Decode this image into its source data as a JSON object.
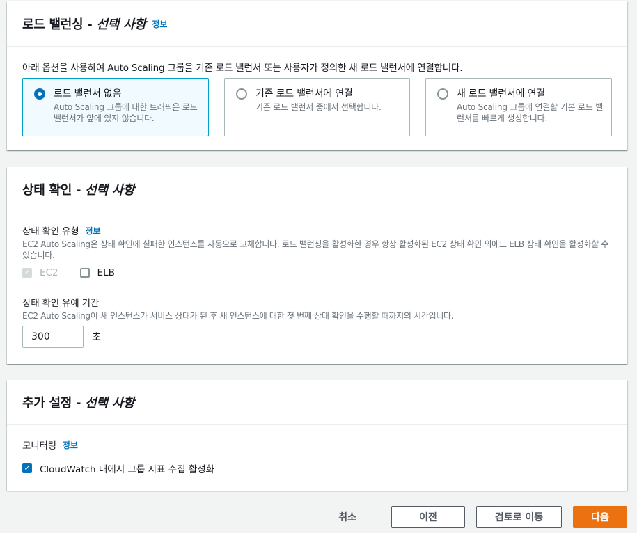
{
  "load_balancing": {
    "title": "로드 밸런싱 - ",
    "title_optional": "선택 사항",
    "info": "정보",
    "description": "아래 옵션을 사용하여 Auto Scaling 그룹을 기존 로드 밸런서 또는 사용자가 정의한 새 로드 밸런서에 연결합니다.",
    "options": [
      {
        "label": "로드 밸런서 없음",
        "desc": "Auto Scaling 그룹에 대한 트래픽은 로드 밸런서가 앞에 있지 않습니다.",
        "selected": true
      },
      {
        "label": "기존 로드 밸런서에 연결",
        "desc": "기존 로드 밸런서 중에서 선택합니다.",
        "selected": false
      },
      {
        "label": "새 로드 밸런서에 연결",
        "desc": "Auto Scaling 그룹에 연결할 기본 로드 밸런서를 빠르게 생성합니다.",
        "selected": false
      }
    ]
  },
  "health_check": {
    "title": "상태 확인 - ",
    "title_optional": "선택 사항",
    "type_label": "상태 확인 유형",
    "type_info": "정보",
    "type_desc": "EC2 Auto Scaling은 상태 확인에 실패한 인스턴스를 자동으로 교체합니다. 로드 밸런싱을 활성화한 경우 항상 활성화된 EC2 상태 확인 외에도 ELB 상태 확인을 활성화할 수 있습니다.",
    "ec2_label": "EC2",
    "elb_label": "ELB",
    "grace_label": "상태 확인 유예 기간",
    "grace_desc": "EC2 Auto Scaling이 새 인스턴스가 서비스 상태가 된 후 새 인스턴스에 대한 첫 번째 상태 확인을 수행할 때까지의 시간입니다.",
    "grace_value": "300",
    "grace_unit": "초"
  },
  "additional": {
    "title": "추가 설정 - ",
    "title_optional": "선택 사항",
    "monitoring_label": "모니터링",
    "monitoring_info": "정보",
    "cloudwatch_label": "CloudWatch 내에서 그룹 지표 수집 활성화"
  },
  "footer": {
    "cancel": "취소",
    "previous": "이전",
    "review": "검토로 이동",
    "next": "다음"
  },
  "colors": {
    "primary": "#ec7211",
    "link": "#0073bb",
    "selected_border": "#00a1c9"
  }
}
